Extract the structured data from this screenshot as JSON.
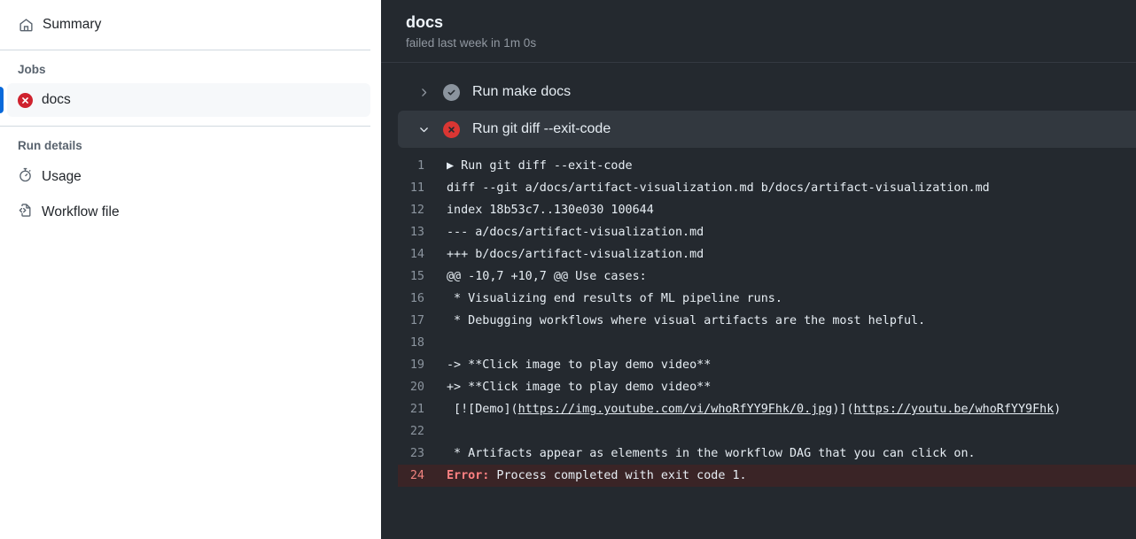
{
  "sidebar": {
    "summary": {
      "label": "Summary",
      "icon": "home-icon"
    },
    "jobs_heading": "Jobs",
    "jobs": [
      {
        "label": "docs",
        "status": "failed",
        "icon": "failure-x-icon",
        "selected": true
      }
    ],
    "run_details_heading": "Run details",
    "run_details": [
      {
        "label": "Usage",
        "icon": "stopwatch-icon"
      },
      {
        "label": "Workflow file",
        "icon": "code-file-icon"
      }
    ]
  },
  "main": {
    "title": "docs",
    "subtitle": "failed last week in 1m 0s",
    "steps": [
      {
        "label": "Run make docs",
        "status": "success",
        "expanded": false,
        "chevron": "chevron-right-icon"
      },
      {
        "label": "Run git diff --exit-code",
        "status": "failure",
        "expanded": true,
        "chevron": "chevron-down-icon"
      }
    ]
  },
  "log": {
    "lines": [
      {
        "n": "1",
        "text": "▶ Run git diff --exit-code"
      },
      {
        "n": "11",
        "text": "diff --git a/docs/artifact-visualization.md b/docs/artifact-visualization.md"
      },
      {
        "n": "12",
        "text": "index 18b53c7..130e030 100644"
      },
      {
        "n": "13",
        "text": "--- a/docs/artifact-visualization.md"
      },
      {
        "n": "14",
        "text": "+++ b/docs/artifact-visualization.md"
      },
      {
        "n": "15",
        "text": "@@ -10,7 +10,7 @@ Use cases:"
      },
      {
        "n": "16",
        "text": " * Visualizing end results of ML pipeline runs."
      },
      {
        "n": "17",
        "text": " * Debugging workflows where visual artifacts are the most helpful."
      },
      {
        "n": "18",
        "text": ""
      },
      {
        "n": "19",
        "text": "-> **Click image to play demo video**"
      },
      {
        "n": "20",
        "text": "+> **Click image to play demo video**"
      },
      {
        "n": "21",
        "text": " [![Demo](https://img.youtube.com/vi/whoRfYY9Fhk/0.jpg)](https://youtu.be/whoRfYY9Fhk)",
        "links": [
          {
            "pre": " [![Demo](",
            "url": "https://img.youtube.com/vi/whoRfYY9Fhk/0.jpg",
            "mid": ")](",
            "url2": "https://youtu.be/whoRfYY9Fhk",
            "post": ")"
          }
        ]
      },
      {
        "n": "22",
        "text": ""
      },
      {
        "n": "23",
        "text": " * Artifacts appear as elements in the workflow DAG that you can click on."
      },
      {
        "n": "24",
        "text": "Error: Process completed with exit code 1.",
        "error": true,
        "error_label": "Error:",
        "error_rest": " Process completed with exit code 1."
      }
    ]
  },
  "colors": {
    "accent_blue": "#0969da",
    "failure_red": "#cf222e",
    "dark_bg": "#24292f",
    "step_active_bg": "#32383f",
    "error_row_bg": "#3a2426",
    "error_text": "#ff8182"
  }
}
